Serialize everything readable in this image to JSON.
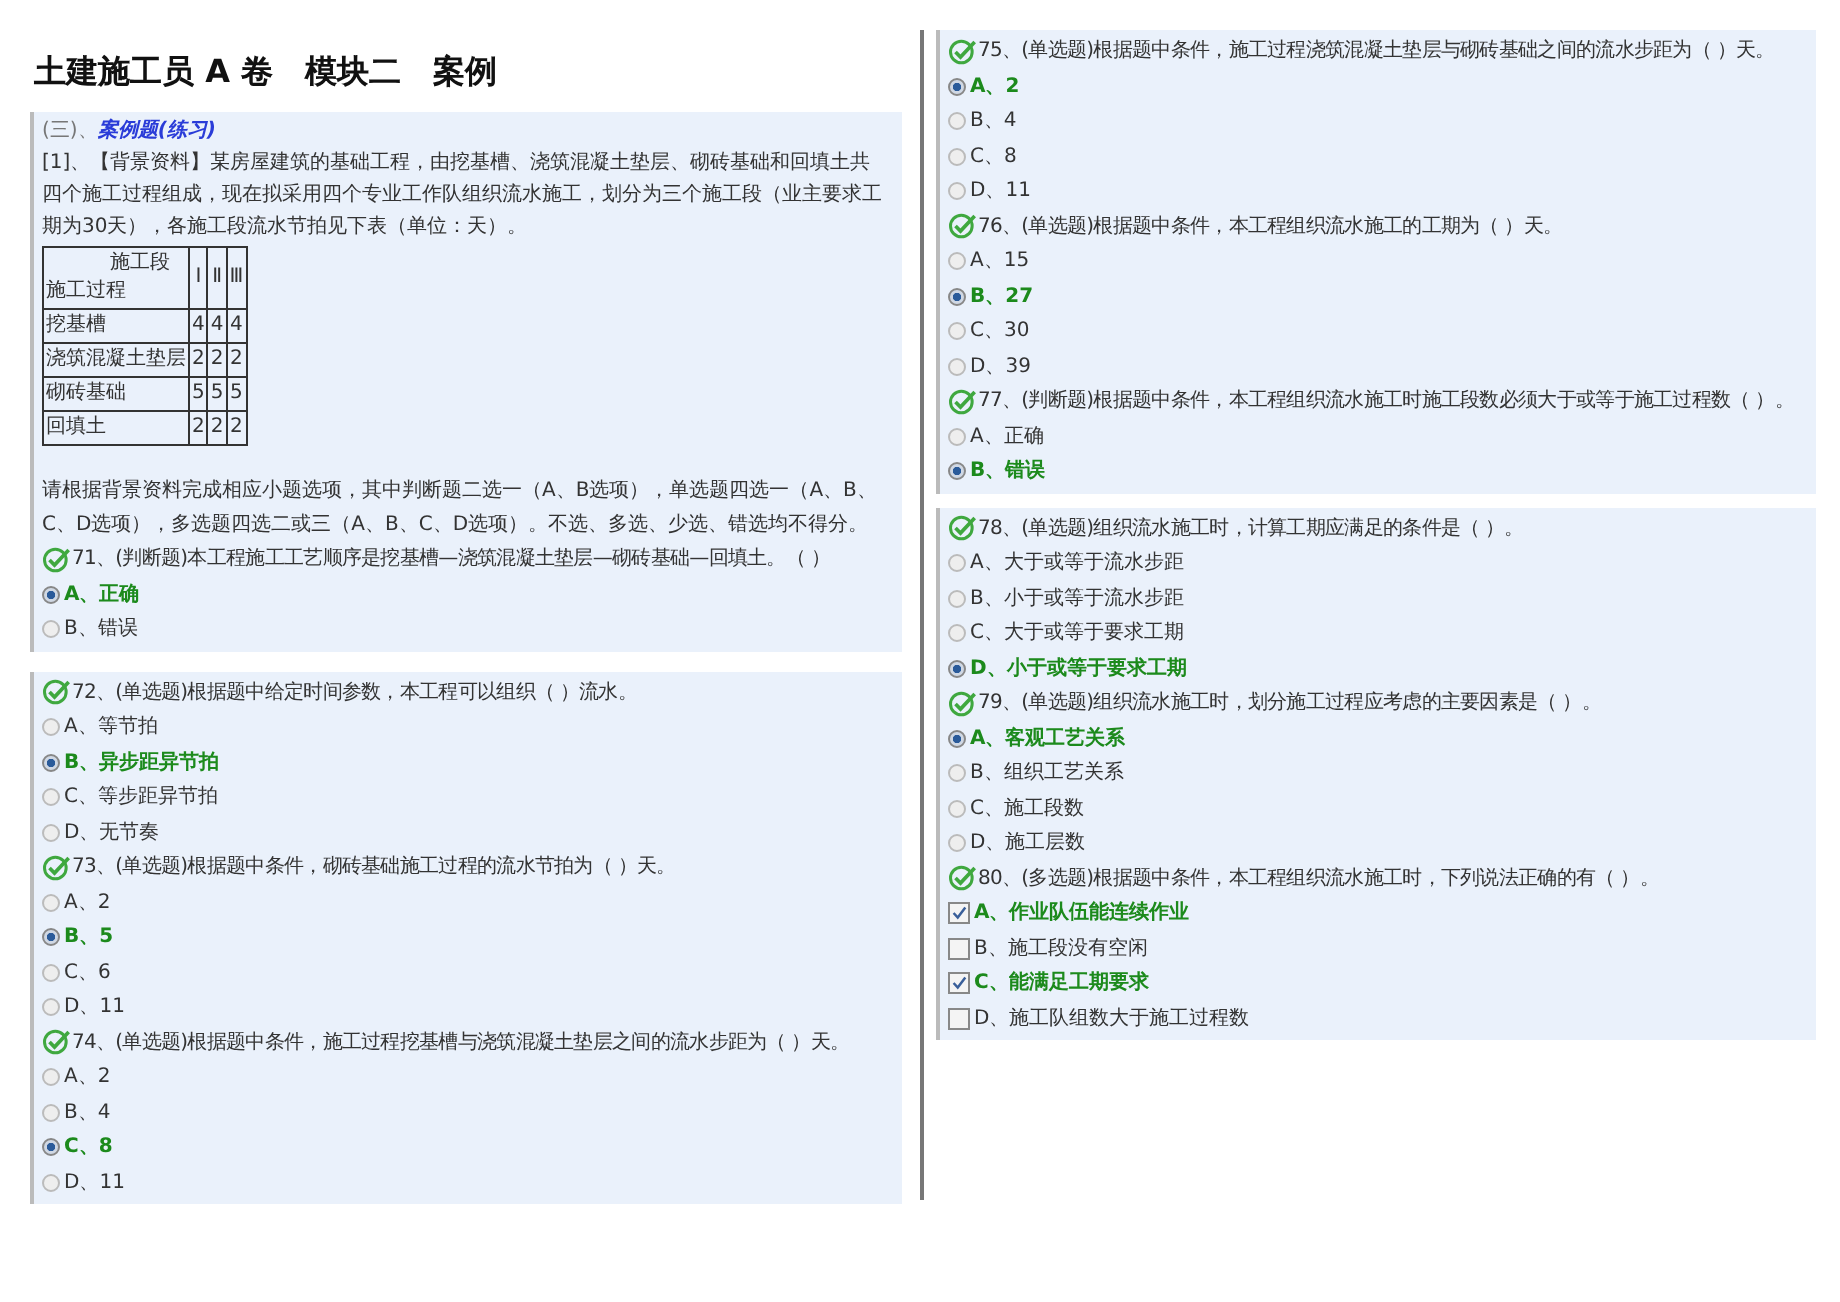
{
  "title": "土建施工员 A 卷　模块二　案例",
  "left_panels": [
    {
      "section": {
        "prefix": "(三)、",
        "name": "案例题(练习)"
      },
      "intro": "[1]、【背景资料】某房屋建筑的基础工程，由挖基槽、浇筑混凝土垫层、砌砖基础和回填土共四个施工过程组成，现在拟采用四个专业工作队组织流水施工，划分为三个施工段（业主要求工期为30天），各施工段流水节拍见下表（单位：天）。",
      "table": {
        "corner_top": "施工段",
        "corner_bottom": "施工过程",
        "columns": [
          "Ⅰ",
          "Ⅱ",
          "Ⅲ"
        ],
        "rows": [
          {
            "name": "挖基槽",
            "cells": [
              "4",
              "4",
              "4"
            ]
          },
          {
            "name": "浇筑混凝土垫层",
            "cells": [
              "2",
              "2",
              "2"
            ]
          },
          {
            "name": "砌砖基础",
            "cells": [
              "5",
              "5",
              "5"
            ]
          },
          {
            "name": "回填土",
            "cells": [
              "2",
              "2",
              "2"
            ]
          }
        ]
      },
      "instructions": "请根据背景资料完成相应小题选项，其中判断题二选一（A、B选项），单选题四选一（A、B、C、D选项），多选题四选二或三（A、B、C、D选项）。不选、多选、少选、错选均不得分。",
      "questions": [
        {
          "text": "71、(判断题)本工程施工工艺顺序是挖基槽—浇筑混凝土垫层—砌砖基础—回填土。（ ）",
          "kind": "radio",
          "options": [
            {
              "label": "A、正确",
              "selected": true
            },
            {
              "label": "B、错误",
              "selected": false
            }
          ]
        }
      ]
    },
    {
      "questions": [
        {
          "text": "72、(单选题)根据题中给定时间参数，本工程可以组织（ ）流水。",
          "kind": "radio",
          "options": [
            {
              "label": "A、等节拍",
              "selected": false
            },
            {
              "label": "B、异步距异节拍",
              "selected": true
            },
            {
              "label": "C、等步距异节拍",
              "selected": false
            },
            {
              "label": "D、无节奏",
              "selected": false
            }
          ]
        },
        {
          "text": "73、(单选题)根据题中条件，砌砖基础施工过程的流水节拍为（ ）天。",
          "kind": "radio",
          "options": [
            {
              "label": "A、2",
              "selected": false
            },
            {
              "label": "B、5",
              "selected": true
            },
            {
              "label": "C、6",
              "selected": false
            },
            {
              "label": "D、11",
              "selected": false
            }
          ]
        },
        {
          "text": "74、(单选题)根据题中条件，施工过程挖基槽与浇筑混凝土垫层之间的流水步距为（ ）天。",
          "kind": "radio",
          "options": [
            {
              "label": "A、2",
              "selected": false
            },
            {
              "label": "B、4",
              "selected": false
            },
            {
              "label": "C、8",
              "selected": true
            },
            {
              "label": "D、11",
              "selected": false
            }
          ]
        }
      ]
    }
  ],
  "right_panels": [
    {
      "questions": [
        {
          "text": "75、(单选题)根据题中条件，施工过程浇筑混凝土垫层与砌砖基础之间的流水步距为（ ）天。",
          "kind": "radio",
          "options": [
            {
              "label": "A、2",
              "selected": true
            },
            {
              "label": "B、4",
              "selected": false
            },
            {
              "label": "C、8",
              "selected": false
            },
            {
              "label": "D、11",
              "selected": false
            }
          ]
        },
        {
          "text": "76、(单选题)根据题中条件，本工程组织流水施工的工期为（ ）天。",
          "kind": "radio",
          "options": [
            {
              "label": "A、15",
              "selected": false
            },
            {
              "label": "B、27",
              "selected": true
            },
            {
              "label": "C、30",
              "selected": false
            },
            {
              "label": "D、39",
              "selected": false
            }
          ]
        },
        {
          "text": "77、(判断题)根据题中条件，本工程组织流水施工时施工段数必须大于或等于施工过程数（ ）。",
          "kind": "radio",
          "options": [
            {
              "label": "A、正确",
              "selected": false
            },
            {
              "label": "B、错误",
              "selected": true
            }
          ]
        }
      ]
    },
    {
      "questions": [
        {
          "text": "78、(单选题)组织流水施工时，计算工期应满足的条件是（ ）。",
          "kind": "radio",
          "options": [
            {
              "label": "A、大于或等于流水步距",
              "selected": false
            },
            {
              "label": "B、小于或等于流水步距",
              "selected": false
            },
            {
              "label": "C、大于或等于要求工期",
              "selected": false
            },
            {
              "label": "D、小于或等于要求工期",
              "selected": true
            }
          ]
        },
        {
          "text": "79、(单选题)组织流水施工时，划分施工过程应考虑的主要因素是（ ）。",
          "kind": "radio",
          "options": [
            {
              "label": "A、客观工艺关系",
              "selected": true
            },
            {
              "label": "B、组织工艺关系",
              "selected": false
            },
            {
              "label": "C、施工段数",
              "selected": false
            },
            {
              "label": "D、施工层数",
              "selected": false
            }
          ]
        },
        {
          "text": "80、(多选题)根据题中条件，本工程组织流水施工时，下列说法正确的有（ ）。",
          "kind": "checkbox",
          "options": [
            {
              "label": "A、作业队伍能连续作业",
              "selected": true
            },
            {
              "label": "B、施工段没有空闲",
              "selected": false
            },
            {
              "label": "C、能满足工期要求",
              "selected": true
            },
            {
              "label": "D、施工队组数大于施工过程数",
              "selected": false
            }
          ]
        }
      ]
    }
  ]
}
